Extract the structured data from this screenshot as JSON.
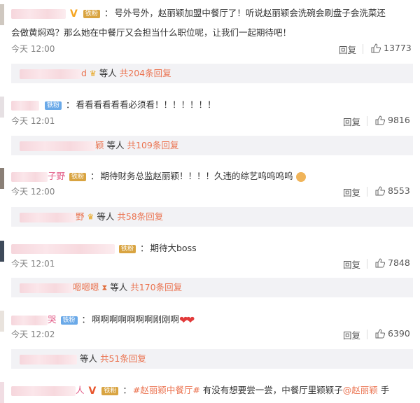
{
  "comments": [
    {
      "text1": "号外号外，赵丽颖加盟中餐厅了！听说赵丽颖会洗碗会刷盘子会洗菜还",
      "text2": "会做黄焖鸡？那么她在中餐厅又会担当什么职位呢，让我们一起期待吧！",
      "time": "今天 12:00",
      "reply": "回复",
      "likes": "13773",
      "sub_tail": "d",
      "sub_people": "等人",
      "sub_count": "共204条回复"
    },
    {
      "text1": "看看看看看看必须看！！！！！！！",
      "time": "今天 12:01",
      "reply": "回复",
      "likes": "9816",
      "sub_tail": "颖",
      "sub_people": "等人",
      "sub_count": "共109条回复"
    },
    {
      "name_tail": "子野",
      "text1": "期待财务总监赵丽颖！！！！久违的综艺呜呜呜呜",
      "time": "今天 12:00",
      "reply": "回复",
      "likes": "8553",
      "sub_tail": "野",
      "sub_people": "等人",
      "sub_count": "共58条回复"
    },
    {
      "text1": "期待大boss",
      "time": "今天 12:01",
      "reply": "回复",
      "likes": "7848",
      "sub_tail": "嗯嗯嗯",
      "sub_people": "等人",
      "sub_count": "共170条回复"
    },
    {
      "name_tail": "哭",
      "text1": "啊啊啊啊啊啊啊刚刚啊",
      "time": "今天 12:02",
      "reply": "回复",
      "likes": "6390",
      "sub_tail": "",
      "sub_people": "等人",
      "sub_count": "共51条回复"
    },
    {
      "name_tail": "人",
      "topic": "#赵丽颖中餐厅#",
      "text1": "有没有想要尝一尝，中餐厅里颖颖子",
      "mention": "@赵丽颖",
      "text_end": "手"
    }
  ],
  "badges": {
    "fan_gold": "铁粉",
    "fan_blue": "铁粉",
    "vip": "V"
  },
  "colors": {
    "accent": "#eb7350",
    "subbox_bg": "#f2f2f5",
    "muted": "#808080"
  }
}
